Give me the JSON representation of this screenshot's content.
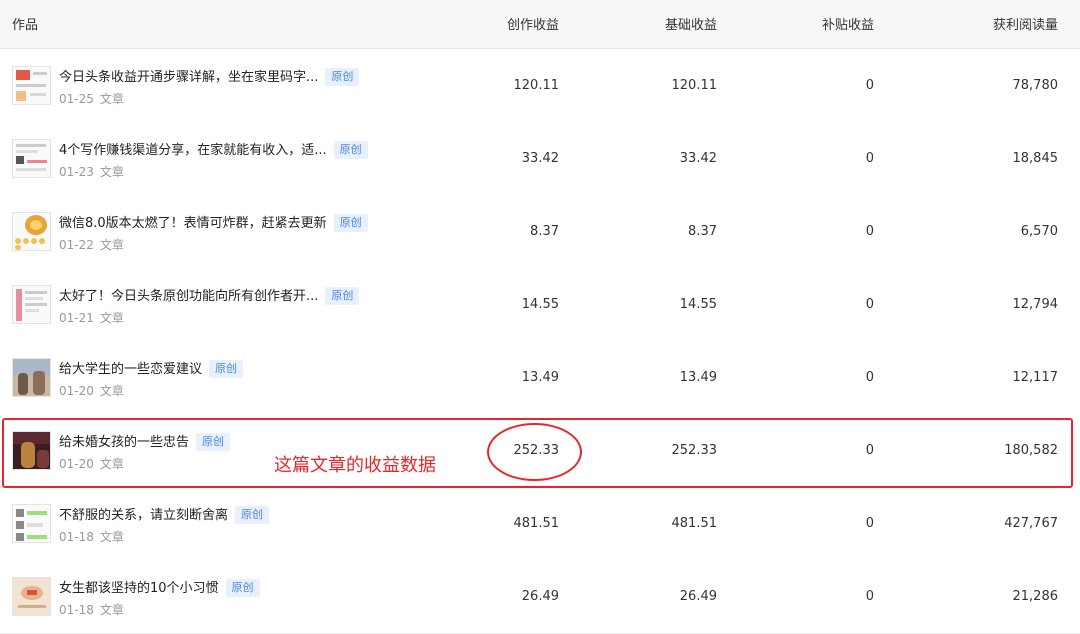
{
  "table": {
    "columns": {
      "work": "作品",
      "creation_income": "创作收益",
      "base_income": "基础收益",
      "subsidy_income": "补贴收益",
      "reads": "获利阅读量"
    },
    "rows": [
      {
        "title": "今日头条收益开通步骤详解，坐在家里码字...",
        "badge": "原创",
        "date": "01-25",
        "type": "文章",
        "creation": "120.11",
        "base": "120.11",
        "subsidy": "0",
        "reads": "78,780"
      },
      {
        "title": "4个写作赚钱渠道分享，在家就能有收入，适...",
        "badge": "原创",
        "date": "01-23",
        "type": "文章",
        "creation": "33.42",
        "base": "33.42",
        "subsidy": "0",
        "reads": "18,845"
      },
      {
        "title": "微信8.0版本太燃了！表情可炸群，赶紧去更新",
        "badge": "原创",
        "date": "01-22",
        "type": "文章",
        "creation": "8.37",
        "base": "8.37",
        "subsidy": "0",
        "reads": "6,570"
      },
      {
        "title": "太好了！今日头条原创功能向所有创作者开...",
        "badge": "原创",
        "date": "01-21",
        "type": "文章",
        "creation": "14.55",
        "base": "14.55",
        "subsidy": "0",
        "reads": "12,794"
      },
      {
        "title": "给大学生的一些恋爱建议",
        "badge": "原创",
        "date": "01-20",
        "type": "文章",
        "creation": "13.49",
        "base": "13.49",
        "subsidy": "0",
        "reads": "12,117"
      },
      {
        "title": "给未婚女孩的一些忠告",
        "badge": "原创",
        "date": "01-20",
        "type": "文章",
        "creation": "252.33",
        "base": "252.33",
        "subsidy": "0",
        "reads": "180,582"
      },
      {
        "title": "不舒服的关系，请立刻断舍离",
        "badge": "原创",
        "date": "01-18",
        "type": "文章",
        "creation": "481.51",
        "base": "481.51",
        "subsidy": "0",
        "reads": "427,767"
      },
      {
        "title": "女生都该坚持的10个小习惯",
        "badge": "原创",
        "date": "01-18",
        "type": "文章",
        "creation": "26.49",
        "base": "26.49",
        "subsidy": "0",
        "reads": "21,286"
      }
    ]
  },
  "annotation": {
    "text": "这篇文章的收益数据",
    "color": "#e8262a"
  }
}
